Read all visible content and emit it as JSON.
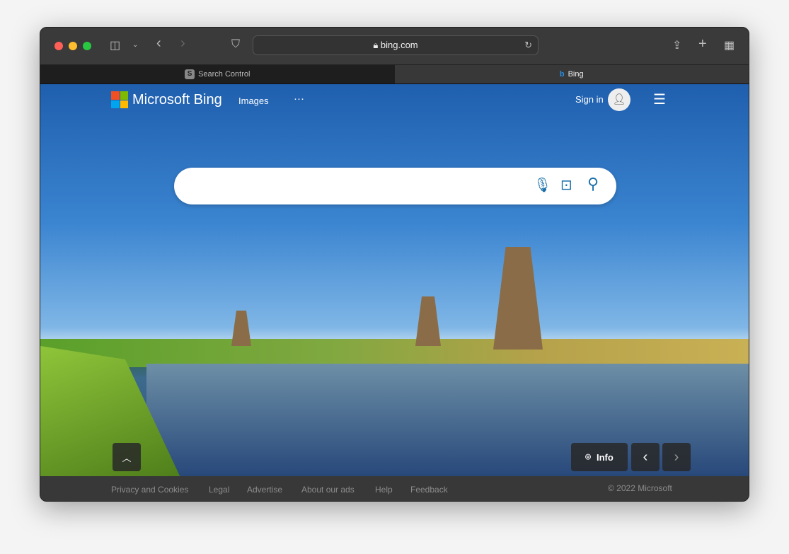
{
  "browser": {
    "url": "bing.com",
    "tabs": [
      {
        "label": "Search Control",
        "favicon": "S",
        "active": false
      },
      {
        "label": "Bing",
        "active": true
      }
    ]
  },
  "header": {
    "brand": "Microsoft Bing",
    "nav": [
      "Images",
      "···"
    ],
    "sign_in": "Sign in"
  },
  "search": {
    "value": "",
    "placeholder": ""
  },
  "controls": {
    "info": "Info"
  },
  "footer": {
    "links": [
      "Privacy and Cookies",
      "Legal",
      "Advertise",
      "About our ads",
      "Help",
      "Feedback"
    ],
    "copyright": "© 2022 Microsoft"
  },
  "colors": {
    "accent": "#1a6fa8",
    "toolbar": "#3a3a3a"
  }
}
